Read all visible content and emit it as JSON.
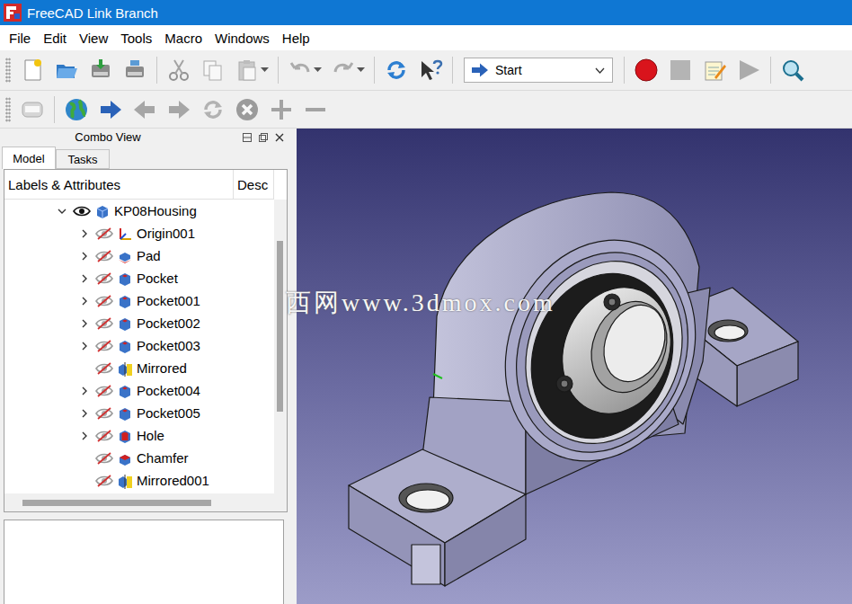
{
  "window": {
    "title": "FreeCAD Link Branch"
  },
  "menu": [
    "File",
    "Edit",
    "View",
    "Tools",
    "Macro",
    "Windows",
    "Help"
  ],
  "toolbars": [
    {
      "groups": [
        [
          {
            "kind": "new",
            "disabled": false,
            "dropdown": false
          },
          {
            "kind": "open",
            "disabled": false,
            "dropdown": false
          },
          {
            "kind": "save",
            "disabled": false,
            "dropdown": false
          },
          {
            "kind": "save-as",
            "disabled": false,
            "dropdown": false
          }
        ],
        [
          {
            "kind": "cut",
            "disabled": true,
            "dropdown": false
          },
          {
            "kind": "copy",
            "disabled": true,
            "dropdown": false
          },
          {
            "kind": "paste",
            "disabled": true,
            "dropdown": true
          }
        ],
        [
          {
            "kind": "undo",
            "disabled": true,
            "dropdown": true
          },
          {
            "kind": "redo",
            "disabled": true,
            "dropdown": true
          }
        ],
        [
          {
            "kind": "refresh",
            "disabled": false,
            "dropdown": false
          },
          {
            "kind": "whats-this",
            "disabled": false,
            "dropdown": false
          }
        ],
        [
          {
            "kind": "select",
            "label": "Start",
            "disabled": false,
            "dropdown": true
          }
        ],
        [
          {
            "kind": "record",
            "disabled": false,
            "dropdown": false
          },
          {
            "kind": "stop",
            "disabled": true,
            "dropdown": false
          },
          {
            "kind": "macro-edit",
            "disabled": false,
            "dropdown": false
          },
          {
            "kind": "play",
            "disabled": true,
            "dropdown": false
          }
        ],
        [
          {
            "kind": "zoom",
            "disabled": false,
            "dropdown": false
          }
        ]
      ]
    },
    {
      "groups": [
        [
          {
            "kind": "box",
            "disabled": true,
            "dropdown": false
          }
        ],
        [
          {
            "kind": "globe",
            "disabled": false,
            "dropdown": false
          },
          {
            "kind": "nav-start",
            "disabled": false,
            "dropdown": false
          },
          {
            "kind": "back",
            "disabled": true,
            "dropdown": false
          },
          {
            "kind": "forward",
            "disabled": true,
            "dropdown": false
          },
          {
            "kind": "reload",
            "disabled": true,
            "dropdown": false
          },
          {
            "kind": "stop-load",
            "disabled": true,
            "dropdown": false
          },
          {
            "kind": "zoom-in",
            "disabled": true,
            "dropdown": false
          },
          {
            "kind": "zoom-out",
            "disabled": true,
            "dropdown": false
          }
        ]
      ]
    }
  ],
  "combo_view": {
    "title": "Combo View",
    "tabs": [
      {
        "label": "Model",
        "selected": true
      },
      {
        "label": "Tasks",
        "selected": false
      }
    ],
    "columns": [
      "Labels & Attributes",
      "Desc"
    ],
    "tree": {
      "label": "KP08Housing",
      "kind": "body",
      "visible": true,
      "expanded": true,
      "has_children": true,
      "children": [
        {
          "label": "Origin001",
          "kind": "origin",
          "visible": false,
          "has_children": true,
          "expanded": false
        },
        {
          "label": "Pad",
          "kind": "pad",
          "visible": false,
          "has_children": true,
          "expanded": false
        },
        {
          "label": "Pocket",
          "kind": "pocket",
          "visible": false,
          "has_children": true,
          "expanded": false
        },
        {
          "label": "Pocket001",
          "kind": "pocket",
          "visible": false,
          "has_children": true,
          "expanded": false
        },
        {
          "label": "Pocket002",
          "kind": "pocket",
          "visible": false,
          "has_children": true,
          "expanded": false
        },
        {
          "label": "Pocket003",
          "kind": "pocket",
          "visible": false,
          "has_children": true,
          "expanded": false
        },
        {
          "label": "Mirrored",
          "kind": "mirrored",
          "visible": false,
          "has_children": false,
          "expanded": false
        },
        {
          "label": "Pocket004",
          "kind": "pocket",
          "visible": false,
          "has_children": true,
          "expanded": false
        },
        {
          "label": "Pocket005",
          "kind": "pocket",
          "visible": false,
          "has_children": true,
          "expanded": false
        },
        {
          "label": "Hole",
          "kind": "hole",
          "visible": false,
          "has_children": true,
          "expanded": false
        },
        {
          "label": "Chamfer",
          "kind": "chamfer",
          "visible": false,
          "has_children": false,
          "expanded": false
        },
        {
          "label": "Mirrored001",
          "kind": "mirrored",
          "visible": false,
          "has_children": false,
          "expanded": false
        }
      ]
    }
  },
  "watermark": "西网www.3dmox.com"
}
